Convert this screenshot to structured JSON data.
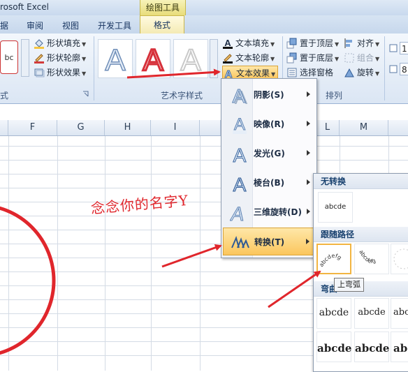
{
  "window": {
    "app_title": "rosoft Excel",
    "context_title": "绘图工具"
  },
  "tabs": [
    "据",
    "审阅",
    "视图",
    "开发工具",
    "格式"
  ],
  "ribbon": {
    "shape_group": {
      "label": "式",
      "fill": "形状填充",
      "outline": "形状轮廓",
      "effects": "形状效果",
      "sample": "bc"
    },
    "wordart_group": {
      "label": "艺术字样式",
      "text_fill": "文本填充",
      "text_outline": "文本轮廓",
      "text_effects": "文本效果"
    },
    "arrange_group": {
      "label": "排列",
      "bring_front": "置于顶层",
      "send_back": "置于底层",
      "selection_pane": "选择窗格",
      "align": "对齐",
      "group": "组合",
      "rotate": "旋转"
    },
    "size_values": [
      "1",
      "8"
    ]
  },
  "columns": [
    "F",
    "G",
    "H",
    "I",
    "L",
    "M"
  ],
  "sheet_text": "念念你的名字Y",
  "effects_menu": [
    {
      "label": "阴影(S)",
      "icon": "wordart-shadow-icon"
    },
    {
      "label": "映像(R)",
      "icon": "wordart-reflection-icon"
    },
    {
      "label": "发光(G)",
      "icon": "wordart-glow-icon"
    },
    {
      "label": "棱台(B)",
      "icon": "wordart-bevel-icon"
    },
    {
      "label": "三维旋转(D)",
      "icon": "wordart-3d-rotation-icon"
    },
    {
      "label": "转换(T)",
      "icon": "wordart-transform-icon"
    }
  ],
  "transform_submenu": {
    "no_transform_header": "无转换",
    "no_transform_sample": "abcde",
    "follow_path_header": "跟随路径",
    "warp_header": "弯曲",
    "warp_sample": "abcde",
    "tooltip": "上弯弧"
  },
  "colors": {
    "accent_red": "#e0262c",
    "menu_highlight": "#fbc65d",
    "ribbon_blue": "#dbe6f4"
  }
}
